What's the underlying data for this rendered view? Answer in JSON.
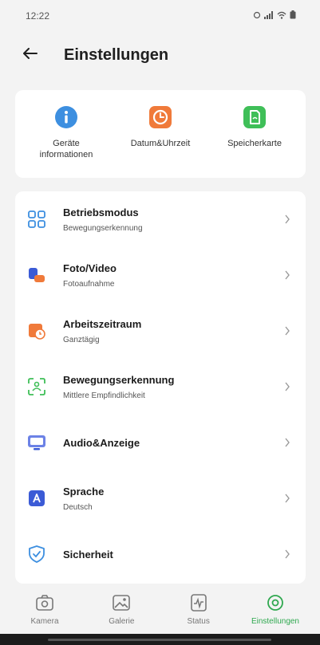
{
  "status_bar": {
    "time": "12:22"
  },
  "app_bar": {
    "title": "Einstellungen"
  },
  "quick_actions": [
    {
      "label_line1": "Geräte",
      "label_line2": "informationen",
      "icon": "info-icon",
      "color": "#3d8fe0"
    },
    {
      "label_line1": "Datum&Uhrzeit",
      "label_line2": "",
      "icon": "clock-icon",
      "color": "#f07a3a"
    },
    {
      "label_line1": "Speicherkarte",
      "label_line2": "",
      "icon": "sd-card-icon",
      "color": "#3fbf58"
    }
  ],
  "settings": [
    {
      "title": "Betriebsmodus",
      "subtitle": "Bewegungserkennung",
      "icon": "grid-icon",
      "color": "#3d8fe0"
    },
    {
      "title": "Foto/Video",
      "subtitle": "Fotoaufnahme",
      "icon": "camera-video-icon",
      "color": "#3b5bd6"
    },
    {
      "title": "Arbeitszeitraum",
      "subtitle": "Ganztägig",
      "icon": "calendar-clock-icon",
      "color": "#f07a3a"
    },
    {
      "title": "Bewegungserkennung",
      "subtitle": "Mittlere Empfindlichkeit",
      "icon": "motion-scan-icon",
      "color": "#3fbf58"
    },
    {
      "title": "Audio&Anzeige",
      "subtitle": "",
      "icon": "monitor-icon",
      "color": "#3b5bd6"
    },
    {
      "title": "Sprache",
      "subtitle": "Deutsch",
      "icon": "language-icon",
      "color": "#3b5bd6"
    },
    {
      "title": "Sicherheit",
      "subtitle": "",
      "icon": "shield-icon",
      "color": "#3d8fe0"
    }
  ],
  "bottom_nav": [
    {
      "label": "Kamera",
      "icon": "camera-icon",
      "active": false
    },
    {
      "label": "Galerie",
      "icon": "gallery-icon",
      "active": false
    },
    {
      "label": "Status",
      "icon": "status-icon",
      "active": false
    },
    {
      "label": "Einstellungen",
      "icon": "settings-icon",
      "active": true
    }
  ],
  "colors": {
    "accent": "#2fa84f",
    "background": "#f3f3f3",
    "card": "#ffffff"
  }
}
